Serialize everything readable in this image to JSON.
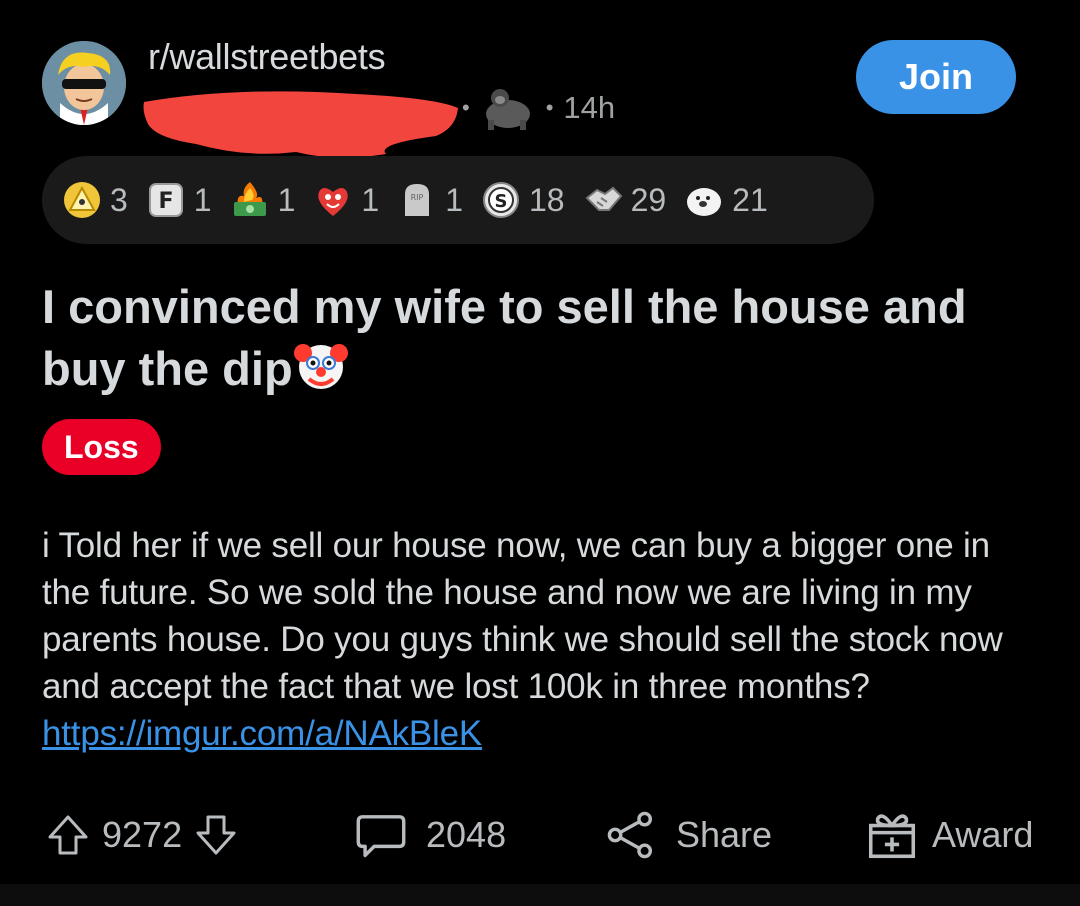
{
  "header": {
    "subreddit": "r/wallstreetbets",
    "time_ago": "14h",
    "join_label": "Join"
  },
  "awards": [
    {
      "icon": "gold-triangle-award-icon",
      "count": "3"
    },
    {
      "icon": "f-key-award-icon",
      "count": "1"
    },
    {
      "icon": "money-fire-award-icon",
      "count": "1"
    },
    {
      "icon": "heart-eyes-award-icon",
      "count": "1"
    },
    {
      "icon": "rip-tombstone-award-icon",
      "count": "1"
    },
    {
      "icon": "silver-s-award-icon",
      "count": "18"
    },
    {
      "icon": "handshake-award-icon",
      "count": "29"
    },
    {
      "icon": "wholesome-seal-award-icon",
      "count": "21"
    }
  ],
  "post": {
    "title": "I convinced my wife to sell the house and buy the dip",
    "flair": "Loss",
    "body_text": "i Told her if we sell our house now, we can buy a bigger one in the future. So we sold the house and now we are living in my parents house. Do you guys think we should sell the stock now and accept the fact that we lost 100k in three months?",
    "link": "https://imgur.com/a/NAkBleK"
  },
  "actions": {
    "score": "9272",
    "comments": "2048",
    "share_label": "Share",
    "award_label": "Award"
  },
  "colors": {
    "background": "#000000",
    "text": "#d7dadc",
    "muted": "#9fa2a4",
    "join_blue": "#3a92e6",
    "flair_red": "#ea0027",
    "award_bar_bg": "#1a1a1b"
  }
}
